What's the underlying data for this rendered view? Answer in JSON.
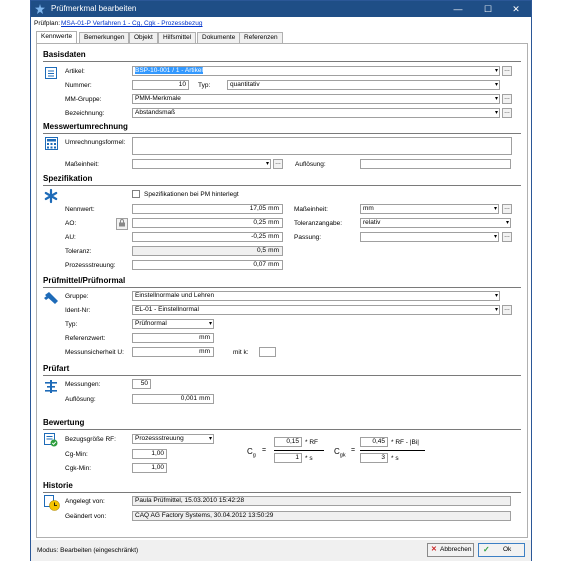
{
  "window": {
    "title": "Prüfmerkmal bearbeiten",
    "min": "—",
    "max": "☐",
    "close": "✕"
  },
  "pruefplan": {
    "label": "Prüfplan:",
    "link": "MSA-01-P Verfahren 1 - Cg, Cgk - Prozessbezug"
  },
  "tabs": [
    "Kennwerte",
    "Bemerkungen",
    "Objekt",
    "Hilfsmittel",
    "Dokumente",
    "Referenzen"
  ],
  "basisdaten": {
    "title": "Basisdaten",
    "artikel_label": "Artikel:",
    "artikel_value": "BSP-10-001 / 1 - Artikel",
    "nummer_label": "Nummer:",
    "nummer_value": "10",
    "typ_label": "Typ:",
    "typ_value": "quantitativ",
    "mm_gruppe_label": "MM-Gruppe:",
    "mm_gruppe_value": "PMM-Merkmale",
    "bezeichnung_label": "Bezeichnung:",
    "bezeichnung_value": "Abstandsmaß"
  },
  "messwert": {
    "title": "Messwertumrechnung",
    "formel_label": "Umrechnungsformel:",
    "formel_value": "",
    "masseinheit_label": "Maßeinheit:",
    "masseinheit_value": "",
    "aufloesung_label": "Auflösung:",
    "aufloesung_value": ""
  },
  "spezifikation": {
    "title": "Spezifikation",
    "checkbox_label": "Spezifikationen bei PM hinterlegt",
    "nennwert_label": "Nennwert:",
    "nennwert_value": "17,05",
    "nennwert_unit": "mm",
    "ao_label": "AO:",
    "ao_value": "0,25",
    "ao_unit": "mm",
    "au_label": "AU:",
    "au_value": "-0,25",
    "au_unit": "mm",
    "toleranz_label": "Toleranz:",
    "toleranz_value": "0,5",
    "toleranz_unit": "mm",
    "streuung_label": "Prozessstreuung:",
    "streuung_value": "0,07",
    "streuung_unit": "mm",
    "masseinheit_label": "Maßeinheit:",
    "masseinheit_value": "mm",
    "toleranzangabe_label": "Toleranzangabe:",
    "toleranzangabe_value": "relativ",
    "passung_label": "Passung:",
    "passung_value": ""
  },
  "pruefmittel": {
    "title": "Prüfmittel/Prüfnormal",
    "gruppe_label": "Gruppe:",
    "gruppe_value": "Einstellnormale und Lehren",
    "ident_label": "Ident-Nr:",
    "ident_value": "EL-01 - Einstellnormal",
    "typ_label": "Typ:",
    "typ_value": "Prüfnormal",
    "referenz_label": "Referenzwert:",
    "referenz_unit": "mm",
    "unsicherheit_label": "Messunsicherheit U:",
    "unsicherheit_unit": "mm",
    "mitk_label": "mit k:"
  },
  "pruefart": {
    "title": "Prüfart",
    "messungen_label": "Messungen:",
    "messungen_value": "50",
    "aufloesung_label": "Auflösung:",
    "aufloesung_value": "0,001",
    "aufloesung_unit": "mm"
  },
  "bewertung": {
    "title": "Bewertung",
    "bezug_label": "Bezugsgröße RF:",
    "bezug_value": "Prozessstreuung",
    "cgmin_label": "Cg-Min:",
    "cgmin_value": "1,00",
    "cgkmin_label": "Cgk-Min:",
    "cgkmin_value": "1,00",
    "cg_symbol": "C",
    "cg_sub": "g",
    "cgk_sub": "gk",
    "eq": "=",
    "cg_num": "0,15",
    "cg_num_suffix": "* RF",
    "cg_den": "1",
    "cg_den_suffix": "* s",
    "cgk_num": "0,45",
    "cgk_num_suffix": "* RF - |Bi|",
    "cgk_den": "3",
    "cgk_den_suffix": "* s"
  },
  "historie": {
    "title": "Historie",
    "angelegt_label": "Angelegt von:",
    "angelegt_value": "Paula Prüfmittel, 15.03.2010 15:42:28",
    "geaendert_label": "Geändert von:",
    "geaendert_value": "CAQ AG Factory Systems, 30.04.2012 13:50:29"
  },
  "status": {
    "mode": "Modus: Bearbeiten (eingeschränkt)"
  },
  "buttons": {
    "cancel": "Abbrechen",
    "ok": "Ok"
  },
  "colors": {
    "titlebar": "#1f4e86",
    "icon_blue": "#1e6bb8",
    "selection": "#3399ff",
    "link": "#0033cc"
  }
}
